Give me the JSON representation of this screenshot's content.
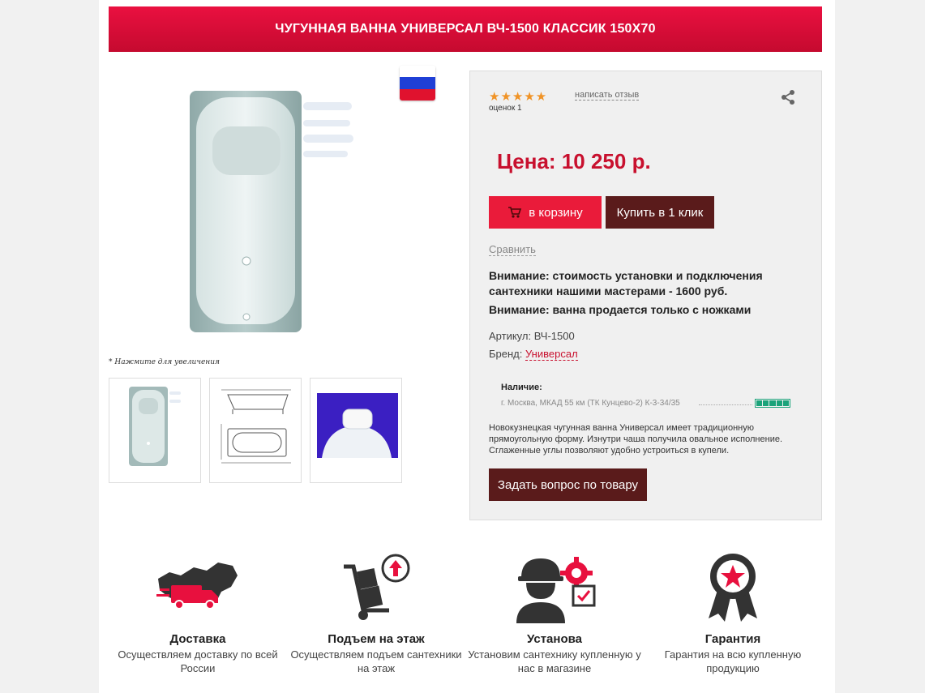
{
  "product": {
    "title": "ЧУГУННАЯ ВАННА УНИВЕРСАЛ ВЧ-1500 КЛАССИК 150Х70",
    "zoom_hint": "* Нажмите для увеличения",
    "flag_country": "Россия",
    "flag_colors": [
      "#ffffff",
      "#1f3fd6",
      "#e0122e"
    ]
  },
  "rating": {
    "stars": "★★★★★",
    "value": 5,
    "max": 5,
    "count_text": "оценок 1",
    "write_review": "написать отзыв"
  },
  "price": {
    "text": "Цена: 10 250 р."
  },
  "buttons": {
    "cart": "в корзину",
    "one_click": "Купить в 1 клик",
    "compare": "Сравнить",
    "question": "Задать вопрос по товару"
  },
  "notices": [
    "Внимание: стоимость установки и подключения сантехники нашими мастерами - 1600 руб.",
    "Внимание: ванна продается только с ножками"
  ],
  "attributes": {
    "sku_label": "Артикул:",
    "sku_value": "ВЧ-1500",
    "brand_label": "Бренд:",
    "brand_value": "Универсал"
  },
  "stock": {
    "label": "Наличие:",
    "store": "г. Москва, МКАД 55 км (ТК Кунцево-2) К-3-34/35",
    "level": 5,
    "level_max": 5
  },
  "description": "Новокузнецкая чугунная ванна Универсал имеет традиционную прямоугольную форму. Изнутри чаша получила овальное исполнение. Сглаженные углы позволяют удобно устроиться в купели.",
  "features": [
    {
      "icon": "delivery-truck-icon",
      "title": "Доставка",
      "text": "Осуществляем доставку по всей России"
    },
    {
      "icon": "floor-lift-icon",
      "title": "Подъем на этаж",
      "text": "Осуществляем подъем сантехники на этаж"
    },
    {
      "icon": "installer-icon",
      "title": "Установа",
      "text": "Установим сантехнику купленную у нас в магазине"
    },
    {
      "icon": "guarantee-medal-icon",
      "title": "Гарантия",
      "text": "Гарантия на всю купленную продукцию"
    }
  ],
  "colors": {
    "accent_red": "#e8103e",
    "dark_maroon": "#5a1b1b",
    "price_red": "#c8102e",
    "star_orange": "#f09326",
    "stock_green": "#1aa37a"
  }
}
